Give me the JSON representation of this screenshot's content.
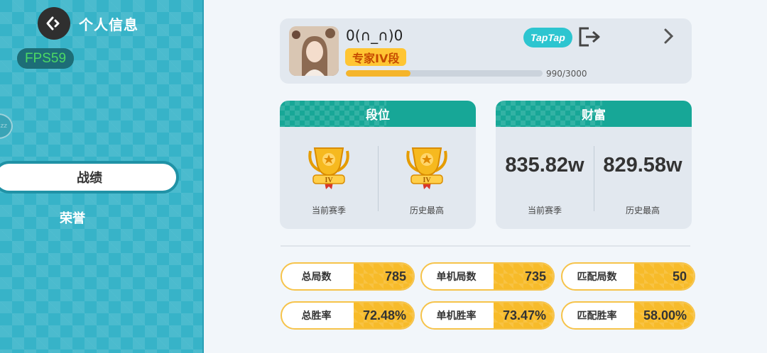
{
  "sidebar": {
    "title": "个人信息",
    "fps": "FPS59",
    "circle_text": "zz",
    "nav_active": "战绩",
    "nav_item": "荣誉"
  },
  "profile": {
    "nickname": "0(∩_∩)0",
    "rank": "专家IV段",
    "xp_text": "990/3000",
    "xp_progress": 0.33,
    "taptap": "TapTap"
  },
  "rank_panel": {
    "title": "段位",
    "current_label": "当前赛季",
    "history_label": "历史最高",
    "tier": "IV"
  },
  "wealth_panel": {
    "title": "财富",
    "current_value": "835.82w",
    "current_label": "当前赛季",
    "history_value": "829.58w",
    "history_label": "历史最高"
  },
  "stats": [
    {
      "label": "总局数",
      "value": "785"
    },
    {
      "label": "单机局数",
      "value": "735"
    },
    {
      "label": "匹配局数",
      "value": "50"
    },
    {
      "label": "总胜率",
      "value": "72.48%"
    },
    {
      "label": "单机胜率",
      "value": "73.47%"
    },
    {
      "label": "匹配胜率",
      "value": "58.00%"
    }
  ],
  "colors": {
    "sidebar": "#37b3c8",
    "header_teal": "#17a797",
    "gold": "#f7bb2a",
    "taptap": "#2dc5d0"
  }
}
